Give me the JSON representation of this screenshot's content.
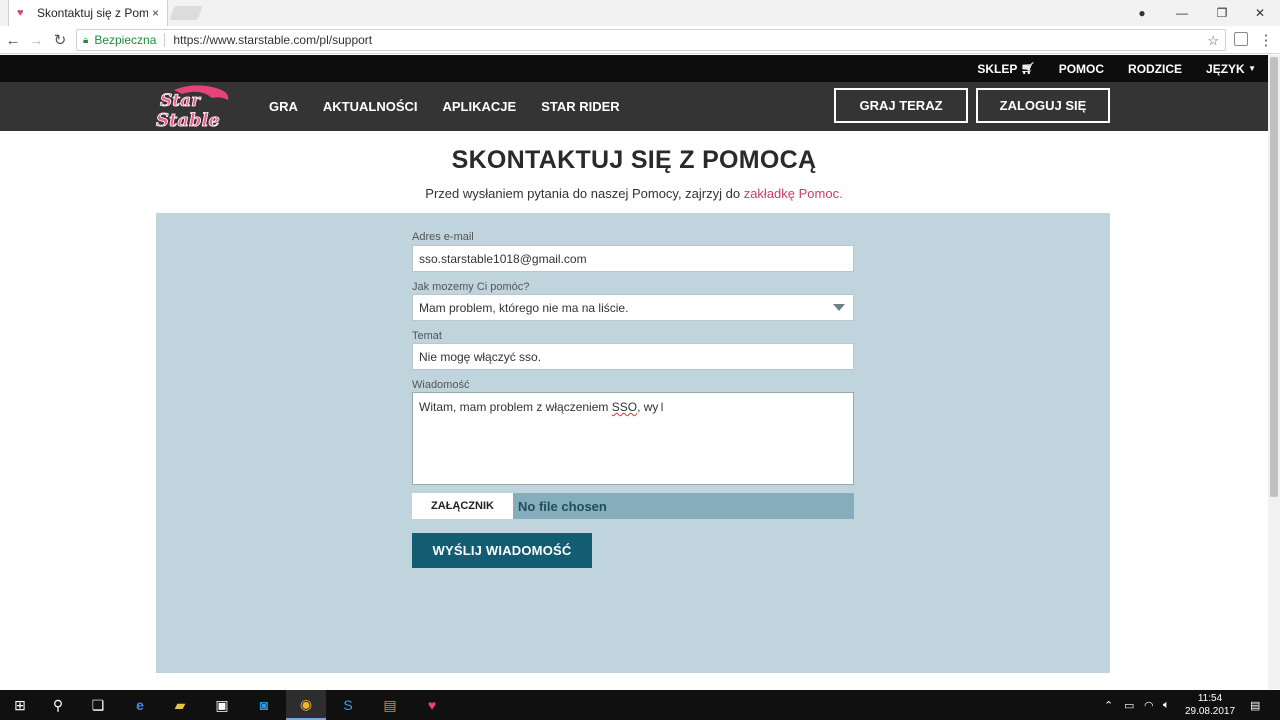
{
  "browser": {
    "tab_title": "Skontaktuj się z Pomocą",
    "tab_close": "×",
    "secure_label": "Bezpieczna",
    "url": "https://www.starstable.com/pl/support",
    "win_min": "—",
    "win_restore": "❐",
    "win_close": "✕"
  },
  "topbar": {
    "links": [
      "SKLEP",
      "POMOC",
      "RODZICE",
      "JĘZYK"
    ]
  },
  "nav": {
    "logo_text": "Star Stable",
    "links": [
      "GRA",
      "AKTUALNOŚCI",
      "APLIKACJE",
      "STAR RIDER"
    ],
    "play_button": "GRAJ TERAZ",
    "login_button": "ZALOGUJ SIĘ"
  },
  "page": {
    "title": "SKONTAKTUJ SIĘ Z POMOCĄ",
    "subtitle_prefix": "Przed wysłaniem pytania do naszej Pomocy, zajrzyj do ",
    "subtitle_link": "zakładkę Pomoc."
  },
  "form": {
    "email_label": "Adres e-mail",
    "email_value": "sso.starstable1018@gmail.com",
    "help_label": "Jak mozemy Ci pomóc?",
    "help_value": "Mam problem, którego nie ma na liście.",
    "subject_label": "Temat",
    "subject_value": "Nie mogę włączyć sso.",
    "message_label": "Wiadomość",
    "message_prefix": "Witam, mam problem z włączeniem ",
    "message_misspelled": "SSO",
    "message_suffix": ", wy",
    "attach_button": "ZAŁĄCZNIK",
    "attach_status": "No file chosen",
    "send_button": "WYŚLIJ WIADOMOŚĆ"
  },
  "taskbar": {
    "time": "11:54",
    "date": "29.08.2017"
  },
  "colors": {
    "accent_pink": "#c5406d",
    "panel_bg": "#bfd4dc",
    "send_button": "#135d73"
  }
}
